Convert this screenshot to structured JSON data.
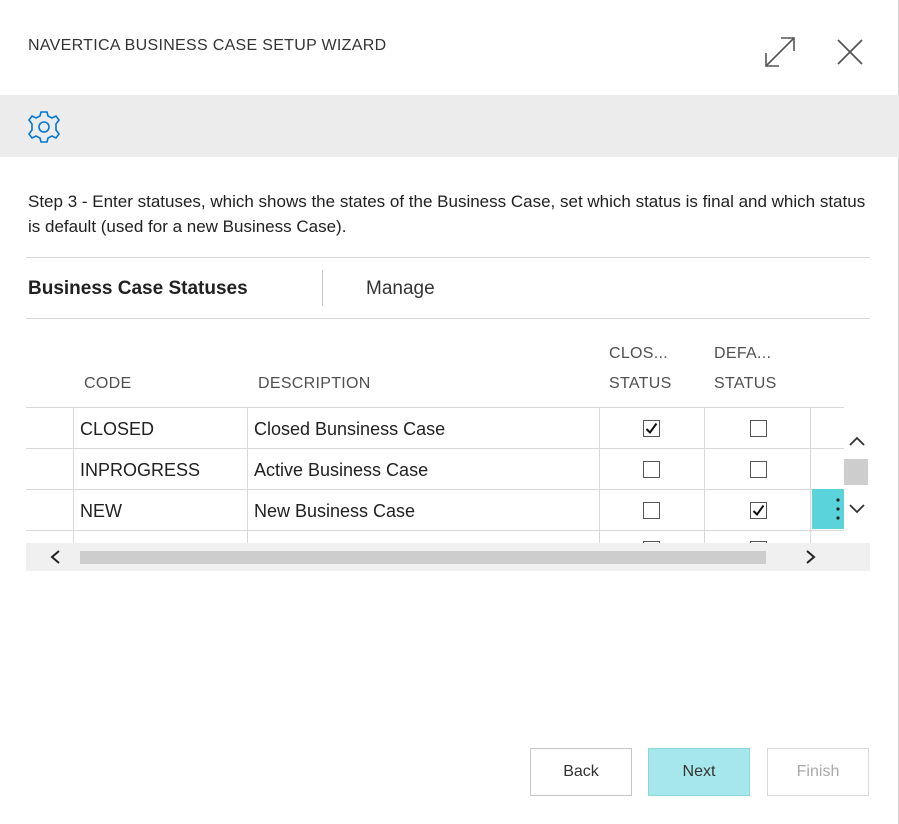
{
  "window": {
    "title": "NAVERTICA BUSINESS CASE SETUP WIZARD",
    "expand_icon": "expand-icon",
    "close_icon": "close-icon"
  },
  "action_bar": {
    "icon": "gear-icon"
  },
  "step": {
    "instructions": "Step 3 - Enter statuses, which shows the states of the Business Case, set which status is final and which status is default (used for a new Business Case)."
  },
  "part": {
    "title": "Business Case Statuses",
    "tabs": [
      {
        "label": "Manage"
      }
    ]
  },
  "grid": {
    "columns": [
      {
        "key": "code",
        "label": "CODE"
      },
      {
        "key": "description",
        "label": "DESCRIPTION"
      },
      {
        "key": "closed",
        "label_line1": "CLOS...",
        "label_line2": "STATUS"
      },
      {
        "key": "default",
        "label_line1": "DEFA...",
        "label_line2": "STATUS"
      }
    ],
    "rows": [
      {
        "code": "CLOSED",
        "description": "Closed Bunsiness Case",
        "closed": true,
        "default": false
      },
      {
        "code": "INPROGRESS",
        "description": "Active Business Case",
        "closed": false,
        "default": false
      },
      {
        "code": "NEW",
        "description": "New Business Case",
        "closed": false,
        "default": true
      }
    ],
    "selected_row_index": 2,
    "row_menu_icon": "more-vertical-icon"
  },
  "scrollbars": {
    "up_icon": "chevron-up-icon",
    "down_icon": "chevron-down-icon",
    "left_icon": "chevron-left-icon",
    "right_icon": "chevron-right-icon"
  },
  "footer": {
    "back_label": "Back",
    "next_label": "Next",
    "finish_label": "Finish"
  },
  "colors": {
    "accent": "#5bd3db",
    "primary_button": "#a6e7eb",
    "action_bar": "#ececec",
    "icon_blue": "#0078d4"
  }
}
